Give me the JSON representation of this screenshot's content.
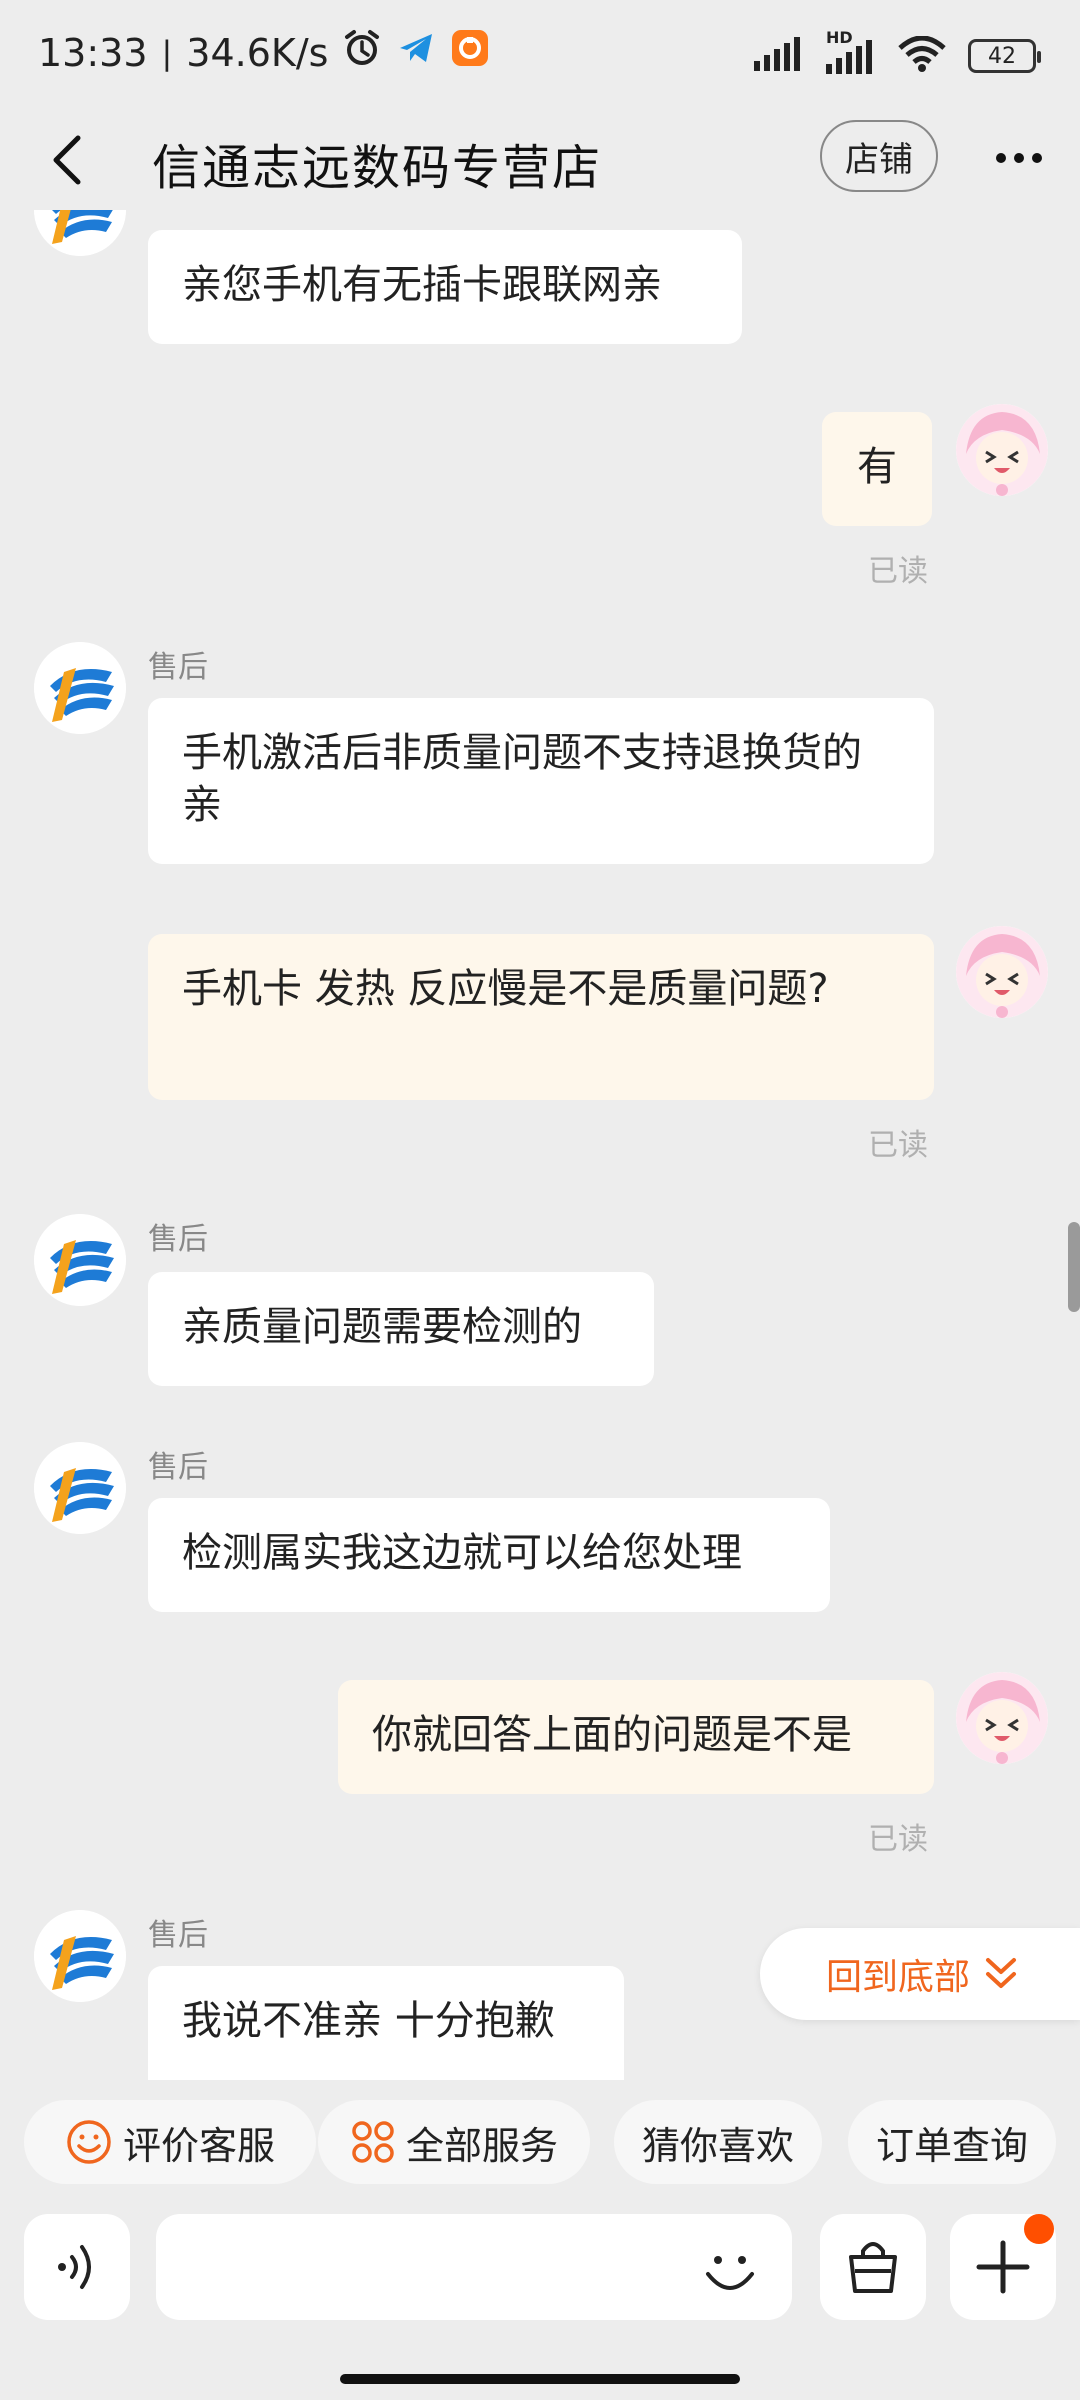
{
  "status_bar": {
    "time": "13:33",
    "separator": "|",
    "net_speed": "34.6K/s",
    "battery": "42",
    "hd_label": "HD"
  },
  "header": {
    "title": "信通志远数码专营店",
    "shop_button": "店铺"
  },
  "messages": [
    {
      "from": "shop",
      "sender": "",
      "text": "亲您手机有无插卡跟联网亲"
    },
    {
      "from": "me",
      "text": "有",
      "status": "已读"
    },
    {
      "from": "shop",
      "sender": "售后",
      "text": "手机激活后非质量问题不支持退换货的亲"
    },
    {
      "from": "me",
      "text": "手机卡 发热 反应慢是不是质量问题?",
      "status": "已读"
    },
    {
      "from": "shop",
      "sender": "售后",
      "text": "亲质量问题需要检测的"
    },
    {
      "from": "shop",
      "sender": "售后",
      "text": "检测属实我这边就可以给您处理"
    },
    {
      "from": "me",
      "text": "你就回答上面的问题是不是",
      "status": "已读"
    },
    {
      "from": "shop",
      "sender": "售后",
      "text": "我说不准亲 十分抱歉"
    }
  ],
  "back_to_bottom": "回到底部",
  "quick_actions": [
    {
      "label": "评价客服",
      "icon": "smile-icon"
    },
    {
      "label": "全部服务",
      "icon": "grid-icon"
    },
    {
      "label": "猜你喜欢",
      "icon": ""
    },
    {
      "label": "订单查询",
      "icon": ""
    }
  ],
  "input": {
    "placeholder": ""
  },
  "colors": {
    "accent": "#f0661e",
    "my_bubble": "#fef7eb",
    "badge": "#ff4f00"
  }
}
